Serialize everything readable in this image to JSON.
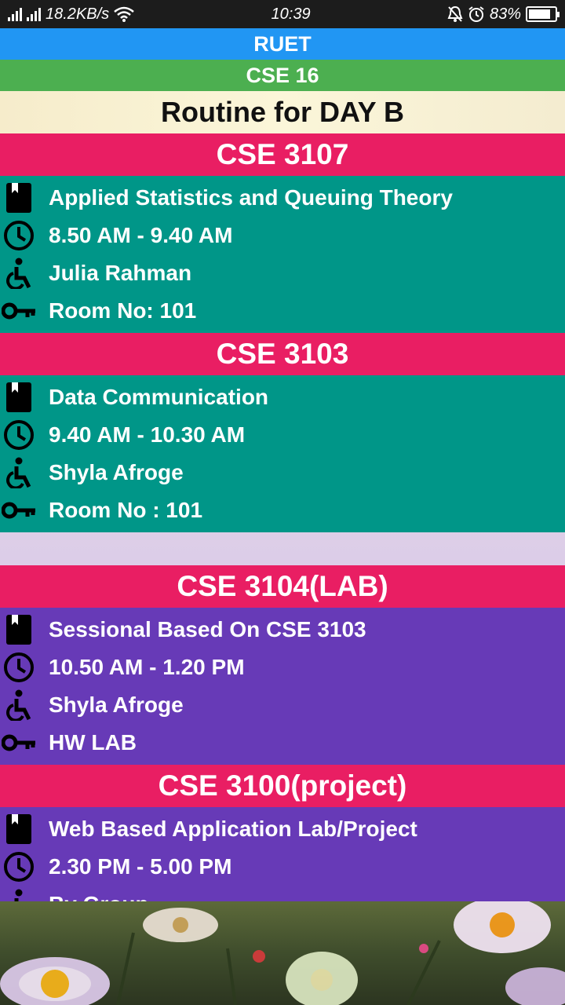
{
  "status_bar": {
    "net_speed": "18.2KB/s",
    "time": "10:39",
    "battery": "83%",
    "battery_level": 0.83,
    "icons": [
      "signal-icon",
      "signal-icon",
      "wifi-icon",
      "mute-bell-icon",
      "alarm-icon",
      "battery-icon"
    ]
  },
  "header": {
    "university": "RUET",
    "batch": "CSE 16",
    "day_title": "Routine for DAY B"
  },
  "colors": {
    "university_bar": "#2196f3",
    "batch_bar": "#4caf50",
    "course_header": "#e91e63",
    "theory_card": "#009688",
    "lab_card": "#673ab7"
  },
  "courses": [
    {
      "code": "CSE 3107",
      "title": "Applied Statistics and Queuing Theory",
      "time": "8.50 AM - 9.40 AM",
      "teacher": "Julia Rahman",
      "room": "Room No: 101"
    },
    {
      "code": "CSE 3103",
      "title": "Data Communication",
      "time": "9.40 AM - 10.30 AM",
      "teacher": "Shyla Afroge",
      "room": "Room No : 101"
    },
    {
      "code": "CSE 3104(LAB)",
      "title": "Sessional Based On CSE 3103",
      "time": "10.50 AM - 1.20 PM",
      "teacher": "Shyla Afroge",
      "room": "HW LAB"
    },
    {
      "code": "CSE 3100(project)",
      "title": "Web Based Application Lab/Project",
      "time": "2.30 PM - 5.00 PM",
      "teacher": "By Group"
    }
  ],
  "row_icons": {
    "title": "book-icon",
    "time": "clock-icon",
    "teacher": "person-icon",
    "room": "key-icon"
  }
}
